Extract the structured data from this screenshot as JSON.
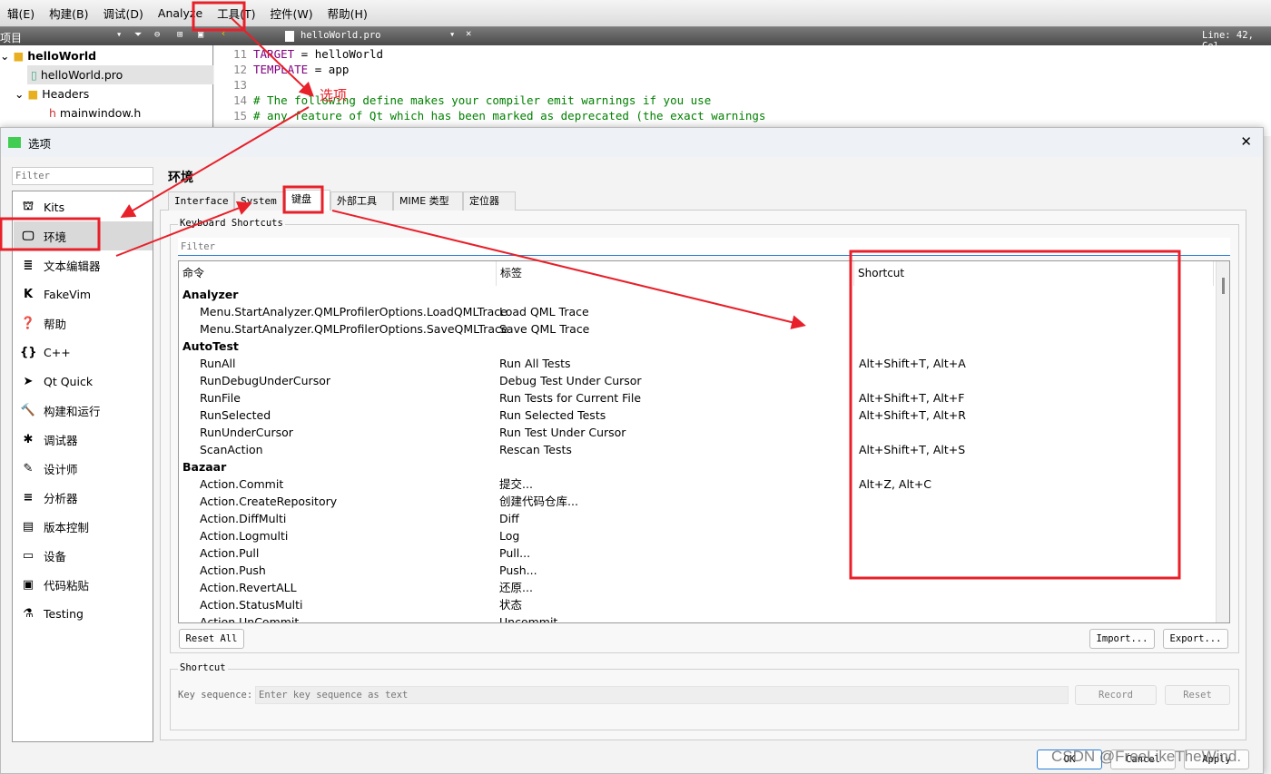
{
  "menubar": {
    "items": [
      "辑(E)",
      "构建(B)",
      "调试(D)",
      "Analyze",
      "工具(T)",
      "控件(W)",
      "帮助(H)"
    ]
  },
  "toolbar": {
    "project_label": "项目",
    "file_tab": "helloWorld.pro",
    "position": "Line: 42, Col"
  },
  "project_tree": [
    "helloWorld",
    "helloWorld.pro",
    "Headers",
    "mainwindow.h"
  ],
  "editor": {
    "lines": [
      {
        "n": "11",
        "kw": "TARGET",
        "rest": " = helloWorld"
      },
      {
        "n": "12",
        "kw": "TEMPLATE",
        "rest": " = app"
      },
      {
        "n": "13",
        "kw": "",
        "rest": ""
      },
      {
        "n": "14",
        "cm": "# The following define makes your compiler emit warnings if you use"
      },
      {
        "n": "15",
        "cm": "# any feature of Qt which has been marked as deprecated (the exact warnings"
      }
    ]
  },
  "annotation": {
    "label": "选项",
    "color": "#e8202a"
  },
  "dialog": {
    "title": "选项",
    "filter_placeholder": "Filter",
    "categories": [
      {
        "icon": "kits-icon",
        "glyph": "⛫",
        "label": "Kits"
      },
      {
        "icon": "monitor-icon",
        "glyph": "🖵",
        "label": "环境"
      },
      {
        "icon": "text-editor-icon",
        "glyph": "≣",
        "label": "文本编辑器"
      },
      {
        "icon": "fakevim-icon",
        "glyph": "K",
        "label": "FakeVim"
      },
      {
        "icon": "help-icon",
        "glyph": "❓",
        "label": "帮助"
      },
      {
        "icon": "cpp-icon",
        "glyph": "{}",
        "label": "C++"
      },
      {
        "icon": "qtquick-icon",
        "glyph": "➤",
        "label": "Qt Quick"
      },
      {
        "icon": "hammer-icon",
        "glyph": "🔨",
        "label": "构建和运行"
      },
      {
        "icon": "bug-icon",
        "glyph": "✱",
        "label": "调试器"
      },
      {
        "icon": "pen-icon",
        "glyph": "✎",
        "label": "设计师"
      },
      {
        "icon": "analyzer-icon",
        "glyph": "≡",
        "label": "分析器"
      },
      {
        "icon": "version-control-icon",
        "glyph": "▤",
        "label": "版本控制"
      },
      {
        "icon": "device-icon",
        "glyph": "▭",
        "label": "设备"
      },
      {
        "icon": "paste-icon",
        "glyph": "▣",
        "label": "代码粘贴"
      },
      {
        "icon": "testing-icon",
        "glyph": "⚗",
        "label": "Testing"
      }
    ],
    "selected_category": "环境",
    "page_title": "环境",
    "tabs": [
      "Interface",
      "System",
      "键盘",
      "外部工具",
      "MIME 类型",
      "定位器"
    ],
    "active_tab": "键盘",
    "shortcuts_group": "Keyboard Shortcuts",
    "shortcut_filter_placeholder": "Filter",
    "columns": [
      "命令",
      "标签",
      "Shortcut"
    ],
    "rows": [
      {
        "group": "Analyzer"
      },
      {
        "cmd": "Menu.StartAnalyzer.QMLProfilerOptions.LoadQMLTrace",
        "label": "Load QML Trace",
        "key": ""
      },
      {
        "cmd": "Menu.StartAnalyzer.QMLProfilerOptions.SaveQMLTrace",
        "label": "Save QML Trace",
        "key": ""
      },
      {
        "group": "AutoTest"
      },
      {
        "cmd": "RunAll",
        "label": "Run All Tests",
        "key": "Alt+Shift+T, Alt+A"
      },
      {
        "cmd": "RunDebugUnderCursor",
        "label": "Debug Test Under Cursor",
        "key": ""
      },
      {
        "cmd": "RunFile",
        "label": "Run Tests for Current File",
        "key": "Alt+Shift+T, Alt+F"
      },
      {
        "cmd": "RunSelected",
        "label": "Run Selected Tests",
        "key": "Alt+Shift+T, Alt+R"
      },
      {
        "cmd": "RunUnderCursor",
        "label": "Run Test Under Cursor",
        "key": ""
      },
      {
        "cmd": "ScanAction",
        "label": "Rescan Tests",
        "key": "Alt+Shift+T, Alt+S"
      },
      {
        "group": "Bazaar"
      },
      {
        "cmd": "Action.Commit",
        "label": "提交...",
        "key": "Alt+Z, Alt+C"
      },
      {
        "cmd": "Action.CreateRepository",
        "label": "创建代码仓库...",
        "key": ""
      },
      {
        "cmd": "Action.DiffMulti",
        "label": "Diff",
        "key": ""
      },
      {
        "cmd": "Action.Logmulti",
        "label": "Log",
        "key": ""
      },
      {
        "cmd": "Action.Pull",
        "label": "Pull...",
        "key": ""
      },
      {
        "cmd": "Action.Push",
        "label": "Push...",
        "key": ""
      },
      {
        "cmd": "Action.RevertALL",
        "label": "还原...",
        "key": ""
      },
      {
        "cmd": "Action.StatusMulti",
        "label": "状态",
        "key": ""
      },
      {
        "cmd": "Action.UnCommit",
        "label": "Uncommit...",
        "key": ""
      }
    ],
    "reset_all": "Reset All",
    "import": "Import...",
    "export": "Export...",
    "shortcut_group": "Shortcut",
    "key_sequence_label": "Key sequence:",
    "key_sequence_placeholder": "Enter key sequence as text",
    "record": "Record",
    "reset": "Reset",
    "ok": "OK",
    "cancel": "Cancel",
    "apply": "Apply"
  },
  "watermark": "CSDN @FreeLikeTheWind."
}
